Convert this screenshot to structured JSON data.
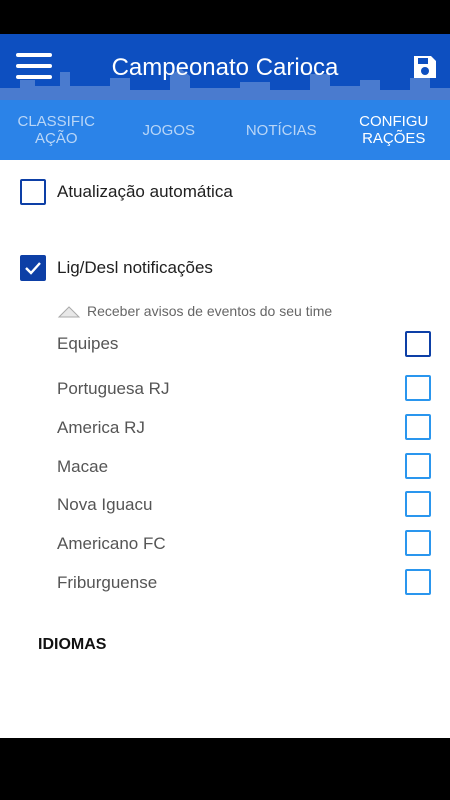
{
  "app": {
    "title": "Campeonato Carioca"
  },
  "colors": {
    "appbar": "#0d4fc0",
    "tabs": "#2b83e8",
    "checkbox_dark": "#0d3fa6",
    "checkbox_light": "#2a96ee"
  },
  "tabs": [
    {
      "label": "CLASSIFICAÇÃO",
      "active": false
    },
    {
      "label": "JOGOS",
      "active": false
    },
    {
      "label": "NOTÍCIAS",
      "active": false
    },
    {
      "label": "CONFIGURAÇÕES",
      "active": true
    }
  ],
  "settings": {
    "auto_update": {
      "label": "Atualização automática",
      "checked": false
    },
    "notifications": {
      "label": "Lig/Desl notificações",
      "checked": true
    },
    "team_alerts_subtitle": "Receber avisos de eventos do seu time",
    "teams_header": {
      "label": "Equipes",
      "checked": false
    },
    "teams": [
      {
        "name": "Portuguesa RJ",
        "checked": false
      },
      {
        "name": "America RJ",
        "checked": false
      },
      {
        "name": "Macae",
        "checked": false
      },
      {
        "name": "Nova Iguacu",
        "checked": false
      },
      {
        "name": "Americano FC",
        "checked": false
      },
      {
        "name": "Friburguense",
        "checked": false
      }
    ],
    "languages_header": "IDIOMAS"
  },
  "icons": {
    "menu": "hamburger-menu-icon",
    "save": "floppy-disk-icon",
    "check": "checkmark-icon",
    "triangle": "triangle-up-icon"
  }
}
